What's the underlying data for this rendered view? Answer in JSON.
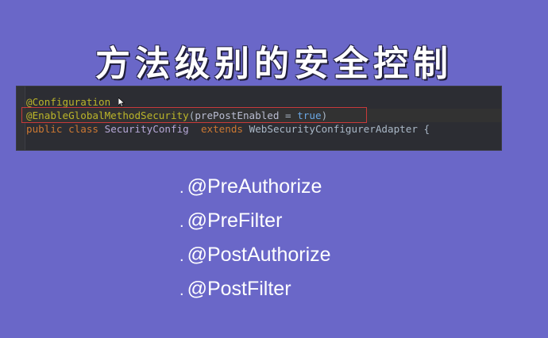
{
  "title": "方法级别的安全控制",
  "code": {
    "line1": {
      "at": "@",
      "annotation": "Configuration"
    },
    "line2": {
      "annotation": "@EnableGlobalMethodSecurity",
      "open_paren": "(",
      "param": "prePostEnabled",
      "equals": " = ",
      "value": "true",
      "close_paren": ")"
    },
    "line3": {
      "kw1": "public",
      "kw2": "class",
      "class_name": "SecurityConfig",
      "kw3": "extends",
      "parent": "WebSecurityConfigurerAdapter",
      "brace": "{"
    }
  },
  "bullets": [
    {
      "dot": ".",
      "text": "@PreAuthorize"
    },
    {
      "dot": ".",
      "text": "@PreFilter"
    },
    {
      "dot": ".",
      "text": "@PostAuthorize"
    },
    {
      "dot": ".",
      "text": "@PostFilter"
    }
  ],
  "colors": {
    "background": "#6a67c8",
    "code_bg": "#2c2d33",
    "highlight_border": "#c83a3a",
    "annotation": "#bbb529",
    "keyword": "#cc7832"
  },
  "icons": {
    "cursor": "mouse-pointer-icon"
  }
}
